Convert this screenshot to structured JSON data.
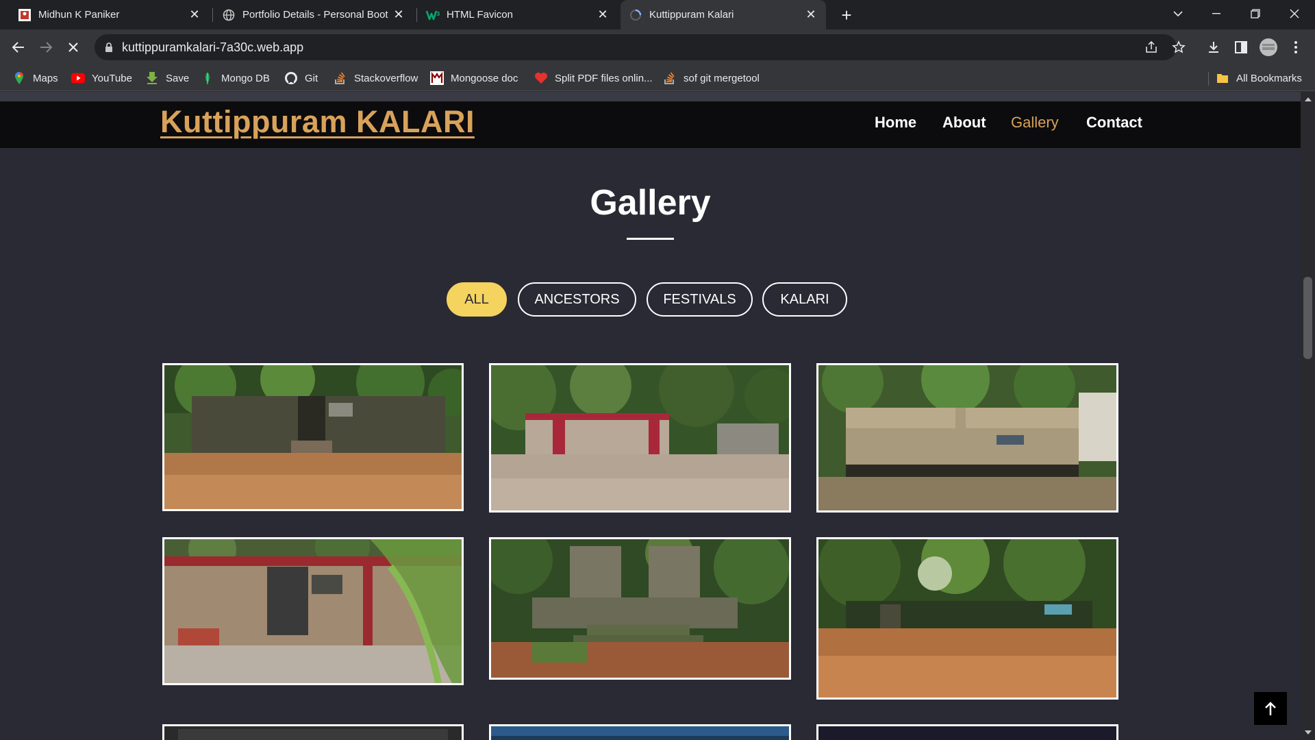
{
  "browser": {
    "tabs": [
      {
        "title": "Midhun K Paniker",
        "icon": "profile-favicon-icon",
        "active": false
      },
      {
        "title": "Portfolio Details - Personal Boot",
        "icon": "globe-icon",
        "active": false
      },
      {
        "title": "HTML Favicon",
        "icon": "w3schools-icon",
        "active": false
      },
      {
        "title": "Kuttippuram Kalari",
        "icon": "loading-spinner-icon",
        "active": true
      }
    ],
    "url": "kuttippuramkalari-7a30c.web.app",
    "bookmarks": [
      {
        "label": "Maps",
        "icon": "maps-icon"
      },
      {
        "label": "YouTube",
        "icon": "youtube-icon"
      },
      {
        "label": "Save",
        "icon": "save-arrow-icon"
      },
      {
        "label": "Mongo DB",
        "icon": "mongodb-leaf-icon"
      },
      {
        "label": "Git",
        "icon": "github-icon"
      },
      {
        "label": "Stackoverflow",
        "icon": "stackoverflow-icon"
      },
      {
        "label": "Mongoose doc",
        "icon": "mongoose-icon"
      },
      {
        "label": "Split PDF files onlin...",
        "icon": "heart-pdf-icon"
      },
      {
        "label": "sof git mergetool",
        "icon": "stackoverflow-icon"
      }
    ],
    "all_bookmarks": "All Bookmarks"
  },
  "site": {
    "logo": "Kuttippuram KALARI",
    "nav": [
      {
        "label": "Home",
        "active": false
      },
      {
        "label": "About",
        "active": false
      },
      {
        "label": "Gallery",
        "active": true
      },
      {
        "label": "Contact",
        "active": false
      }
    ],
    "section_title": "Gallery",
    "filters": [
      {
        "label": "ALL",
        "active": true
      },
      {
        "label": "ANCESTORS",
        "active": false
      },
      {
        "label": "FESTIVALS",
        "active": false
      },
      {
        "label": "KALARI",
        "active": false
      }
    ]
  },
  "colors": {
    "accent": "#d9a25a",
    "filter_active": "#f4d35e",
    "page_bg": "#2a2a35",
    "header_bg": "#0c0c0e"
  }
}
